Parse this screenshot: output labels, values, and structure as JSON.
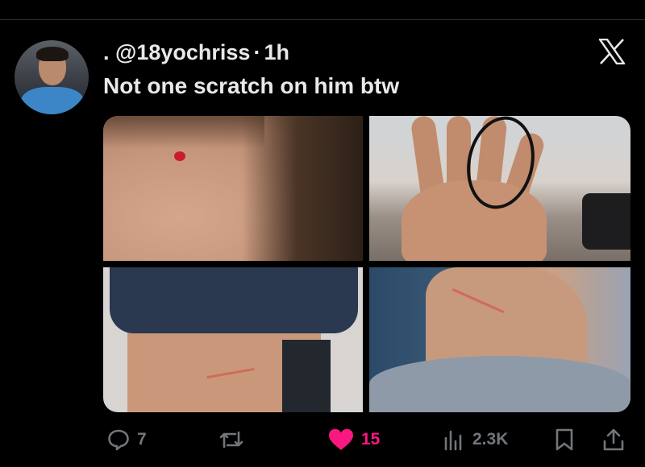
{
  "tweet": {
    "prefix": ".",
    "handle": "@18yochriss",
    "separator": "·",
    "time": "1h",
    "text": "Not one scratch on him btw"
  },
  "platform_logo": "X",
  "media": [
    {
      "name": "face-injury-photo"
    },
    {
      "name": "hand-photo"
    },
    {
      "name": "back-scratch-photo"
    },
    {
      "name": "neck-scratch-photo"
    }
  ],
  "actions": {
    "reply": {
      "icon": "reply-icon",
      "count": "7"
    },
    "repost": {
      "icon": "repost-icon",
      "count": ""
    },
    "like": {
      "icon": "heart-icon",
      "count": "15",
      "color": "#f91880"
    },
    "views": {
      "icon": "views-icon",
      "count": "2.3K"
    },
    "bookmark": {
      "icon": "bookmark-icon"
    },
    "share": {
      "icon": "share-icon"
    }
  },
  "colors": {
    "background": "#000000",
    "text": "#e7e9ea",
    "muted": "#71767b",
    "like": "#f91880"
  }
}
